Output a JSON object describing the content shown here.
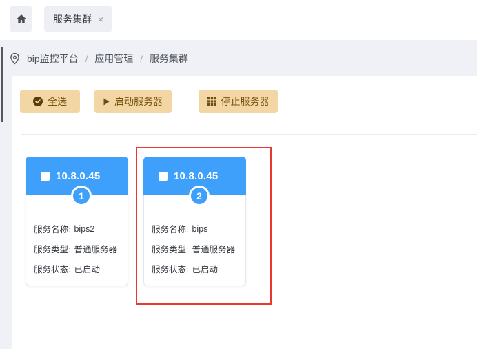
{
  "topbar": {
    "tab": {
      "label": "服务集群",
      "close_glyph": "×"
    }
  },
  "breadcrumb": {
    "separator": "/",
    "items": [
      "bip监控平台",
      "应用管理",
      "服务集群"
    ]
  },
  "toolbar": {
    "buttons": [
      {
        "label": "全选",
        "icon": "check-circle-icon"
      },
      {
        "label": "启动服务器",
        "icon": "play-icon"
      },
      {
        "label": "停止服务器",
        "icon": "grid-icon"
      }
    ]
  },
  "cards": [
    {
      "ip": "10.8.0.45",
      "index": "1",
      "checked": false,
      "rows": [
        {
          "label": "服务名称:",
          "value": "bips2"
        },
        {
          "label": "服务类型:",
          "value": "普通服务器"
        },
        {
          "label": "服务状态:",
          "value": "已启动"
        }
      ]
    },
    {
      "ip": "10.8.0.45",
      "index": "2",
      "checked": false,
      "highlighted": true,
      "rows": [
        {
          "label": "服务名称:",
          "value": "bips"
        },
        {
          "label": "服务类型:",
          "value": "普通服务器"
        },
        {
          "label": "服务状态:",
          "value": "已启动"
        }
      ]
    }
  ],
  "colors": {
    "header_blue": "#3fa0fc",
    "button_bg": "#f2d7a4",
    "button_text": "#7a5210",
    "annotation_red": "#e8382f",
    "page_gray": "#eff1f6"
  }
}
